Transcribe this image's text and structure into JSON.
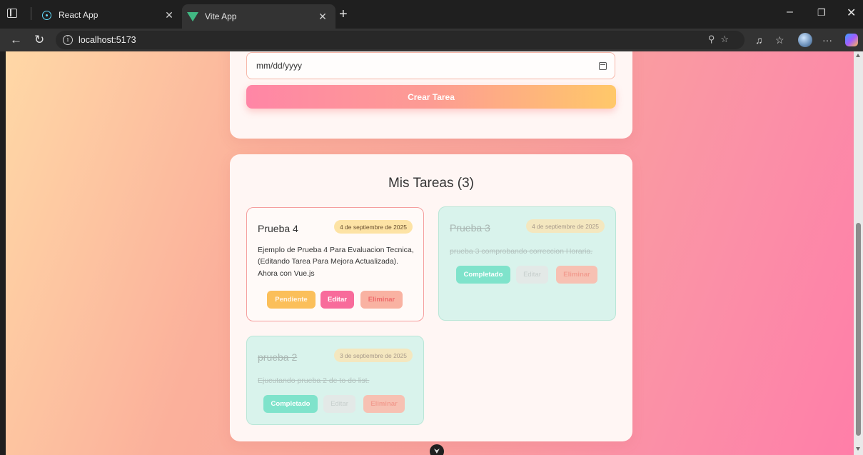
{
  "browser": {
    "tabs": [
      {
        "title": "React App",
        "icon": "react-icon"
      },
      {
        "title": "Vite App",
        "icon": "vue-icon"
      }
    ],
    "address": "localhost:5173"
  },
  "form": {
    "date_placeholder": "mm/dd/yyyy",
    "create_label": "Crear Tarea"
  },
  "tasks": {
    "heading": "Mis Tareas (3)",
    "items": [
      {
        "title": "Prueba 4",
        "date": "4 de septiembre de 2025",
        "description": "Ejemplo de Prueba 4 Para Evaluacion Tecnica, (Editando Tarea Para Mejora Actualizada). Ahora con Vue.js",
        "status_label": "Pendiente",
        "edit_label": "Editar",
        "delete_label": "Eliminar",
        "completed": false
      },
      {
        "title": "Prueba 3",
        "date": "4 de septiembre de 2025",
        "description": "prueba 3 comprobando correccion Horaria.",
        "status_label": "Completado",
        "edit_label": "Editar",
        "delete_label": "Eliminar",
        "completed": true
      },
      {
        "title": "prueba 2",
        "date": "3 de septiembre de 2025",
        "description": "Ejucutando prueba 2 de to do list.",
        "status_label": "Completado",
        "edit_label": "Editar",
        "delete_label": "Eliminar",
        "completed": true
      }
    ]
  },
  "colors": {
    "accent_pink": "#f86b9b",
    "pending_orange": "#fbbf5a",
    "completed_teal": "#7fe3cb"
  }
}
